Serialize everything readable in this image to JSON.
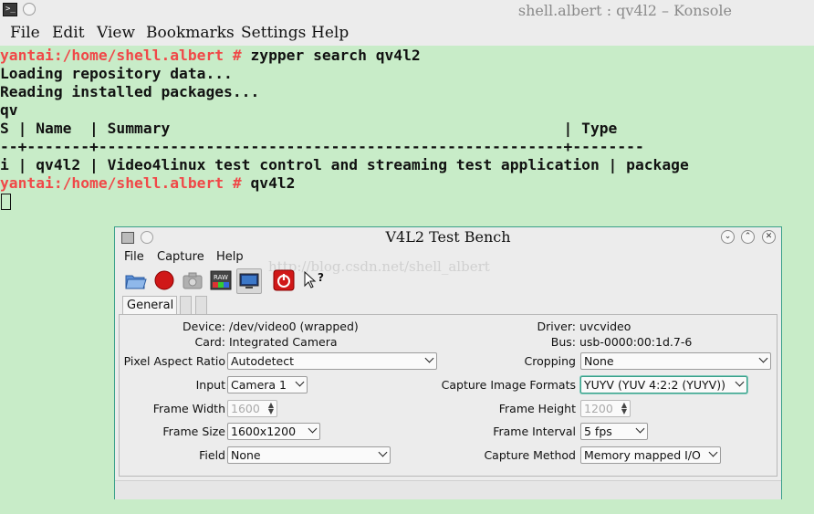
{
  "konsole": {
    "title": "shell.albert : qv4l2 – Konsole",
    "menu": [
      "File",
      "Edit",
      "View",
      "Bookmarks",
      "Settings",
      "Help"
    ]
  },
  "terminal": {
    "prompt1": "yantai:/home/shell.albert #",
    "cmd1": " zypper search qv4l2",
    "line_loading": "Loading repository data...",
    "line_reading": "Reading installed packages...",
    "line_qv": "qv",
    "header": "S | Name  | Summary                                            | Type",
    "divider": "--+-------+----------------------------------------------------+--------",
    "row": "i | qv4l2 | Video4linux test control and streaming test application | package",
    "prompt2": "yantai:/home/shell.albert #",
    "cmd2": " qv4l2"
  },
  "v4l2": {
    "title": "V4L2 Test Bench",
    "menu": [
      "File",
      "Capture",
      "Help"
    ],
    "watermark": "http://blog.csdn.net/shell_albert",
    "tab_general": "General",
    "device_label": "Device:",
    "device_value": "/dev/video0 (wrapped)",
    "card_label": "Card:",
    "card_value": "Integrated Camera",
    "driver_label": "Driver:",
    "driver_value": "uvcvideo",
    "bus_label": "Bus:",
    "bus_value": "usb-0000:00:1d.7-6",
    "pixel_aspect_label": "Pixel Aspect Ratio",
    "pixel_aspect_value": "Autodetect",
    "cropping_label": "Cropping",
    "cropping_value": "None",
    "input_label": "Input",
    "input_value": "Camera 1",
    "capture_formats_label": "Capture Image Formats",
    "capture_formats_value": "YUYV (YUV 4:2:2 (YUYV))",
    "frame_width_label": "Frame Width",
    "frame_width_value": "1600",
    "frame_height_label": "Frame Height",
    "frame_height_value": "1200",
    "frame_size_label": "Frame Size",
    "frame_size_value": "1600x1200",
    "frame_interval_label": "Frame Interval",
    "frame_interval_value": "5 fps",
    "field_label": "Field",
    "field_value": "None",
    "capture_method_label": "Capture Method",
    "capture_method_value": "Memory mapped I/O"
  }
}
